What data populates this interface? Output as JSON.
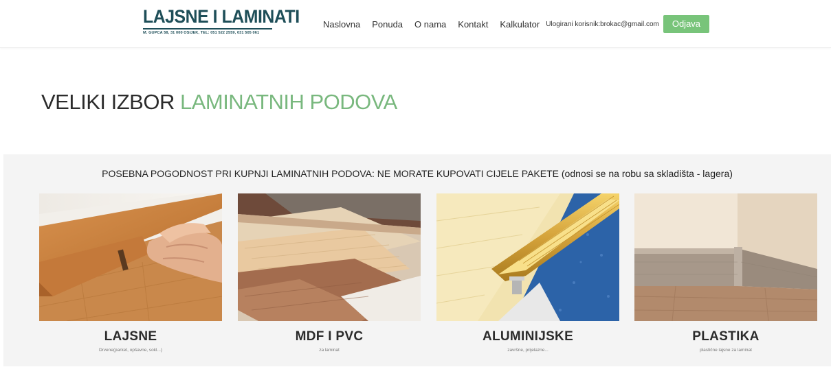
{
  "header": {
    "logo_title": "LAJSNE I LAMINATI",
    "logo_subtitle": "M. GUPCA 58, 31 000 OSIJEK, TEL: 051 522 2559, 031 505 061",
    "nav": [
      "Naslovna",
      "Ponuda",
      "O nama",
      "Kontakt",
      "Kalkulator"
    ],
    "user_label": "Ulogirani korisnik:brokac@gmail.com",
    "logout_label": "Odjava"
  },
  "headline": {
    "part1": "VELIKI IZBOR ",
    "part2": "LAMINATNIH PODOVA"
  },
  "promo": "POSEBNA POGODNOST PRI KUPNJI LAMINATNIH PODOVA: NE MORATE KUPOVATI CIJELE PAKETE (odnosi se na robu sa skladišta - lagera)",
  "categories": [
    {
      "title": "LAJSNE",
      "desc": "Drvene(parket, opšavne, sokl...)"
    },
    {
      "title": "MDF I PVC",
      "desc": "za laminat"
    },
    {
      "title": "ALUMINIJSKE",
      "desc": "završne, prijelazne..."
    },
    {
      "title": "PLASTIKA",
      "desc": "plastične lajsne za laminat"
    }
  ],
  "colors": {
    "brand": "#1e4e58",
    "accent": "#79b87e",
    "button": "#78c47a"
  }
}
